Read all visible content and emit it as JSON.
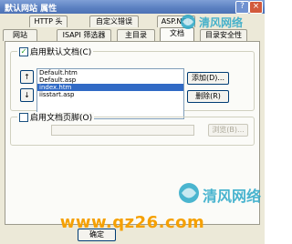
{
  "window": {
    "title": "默认网站 属性"
  },
  "tabs_row1": [
    {
      "label": "HTTP 头"
    },
    {
      "label": "自定义错误"
    },
    {
      "label": "ASP.NET"
    }
  ],
  "tabs_row2": [
    {
      "label": "网站"
    },
    {
      "label": "ISAPI 筛选器"
    },
    {
      "label": "主目录"
    },
    {
      "label": "文档"
    },
    {
      "label": "目录安全性"
    }
  ],
  "default_doc": {
    "checkbox_label": "启用默认文档(C)",
    "checked": true,
    "items": [
      {
        "name": "Default.htm"
      },
      {
        "name": "Default.asp"
      },
      {
        "name": "index.htm"
      },
      {
        "name": "iisstart.asp"
      }
    ],
    "selected_index": 2,
    "up_glyph": "↑",
    "down_glyph": "↓",
    "add_label": "添加(D)...",
    "remove_label": "删除(R)"
  },
  "footer_doc": {
    "checkbox_label": "启用文档页脚(O)",
    "checked": false,
    "input_value": "",
    "browse_label": "浏览(B)..."
  },
  "buttons": {
    "ok_label": "确定"
  },
  "watermarks": {
    "logo_text": "清风网络",
    "site_text": "www.qz26.com"
  },
  "colors": {
    "accent": "#316ac5",
    "titlebar": "#5a7fc0",
    "watermark": "#f5a000"
  },
  "icons": {
    "help": "question-icon",
    "close": "close-icon"
  }
}
